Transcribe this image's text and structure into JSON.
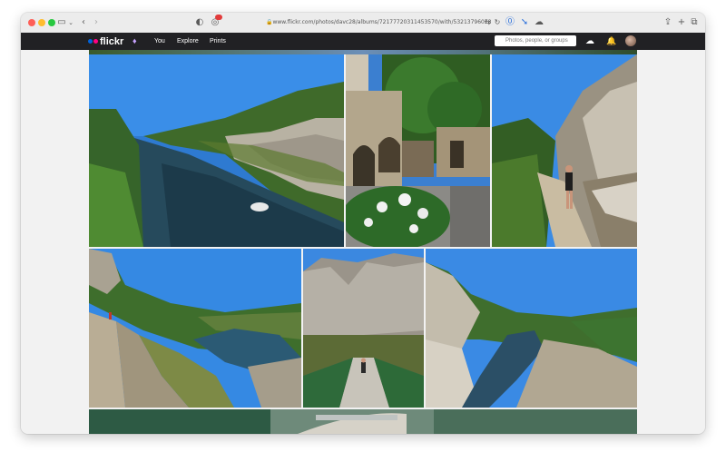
{
  "browser": {
    "url": "www.flickr.com/photos/davc28/albums/72177720311453570/with/53213796078",
    "icons": {
      "sidebar": "sidebar-icon",
      "back": "chevron-left-icon",
      "forward": "chevron-right-icon",
      "share": "share-icon",
      "new_tab": "plus-icon",
      "tabs": "tabs-overview-icon"
    }
  },
  "flickr": {
    "logo": "flickr",
    "nav": {
      "you": "You",
      "explore": "Explore",
      "prints": "Prints"
    },
    "search_placeholder": "Photos, people, or groups",
    "colors": {
      "nav_bg": "#212124",
      "blue_dot": "#0063dc",
      "pink_dot": "#ff0084"
    }
  }
}
